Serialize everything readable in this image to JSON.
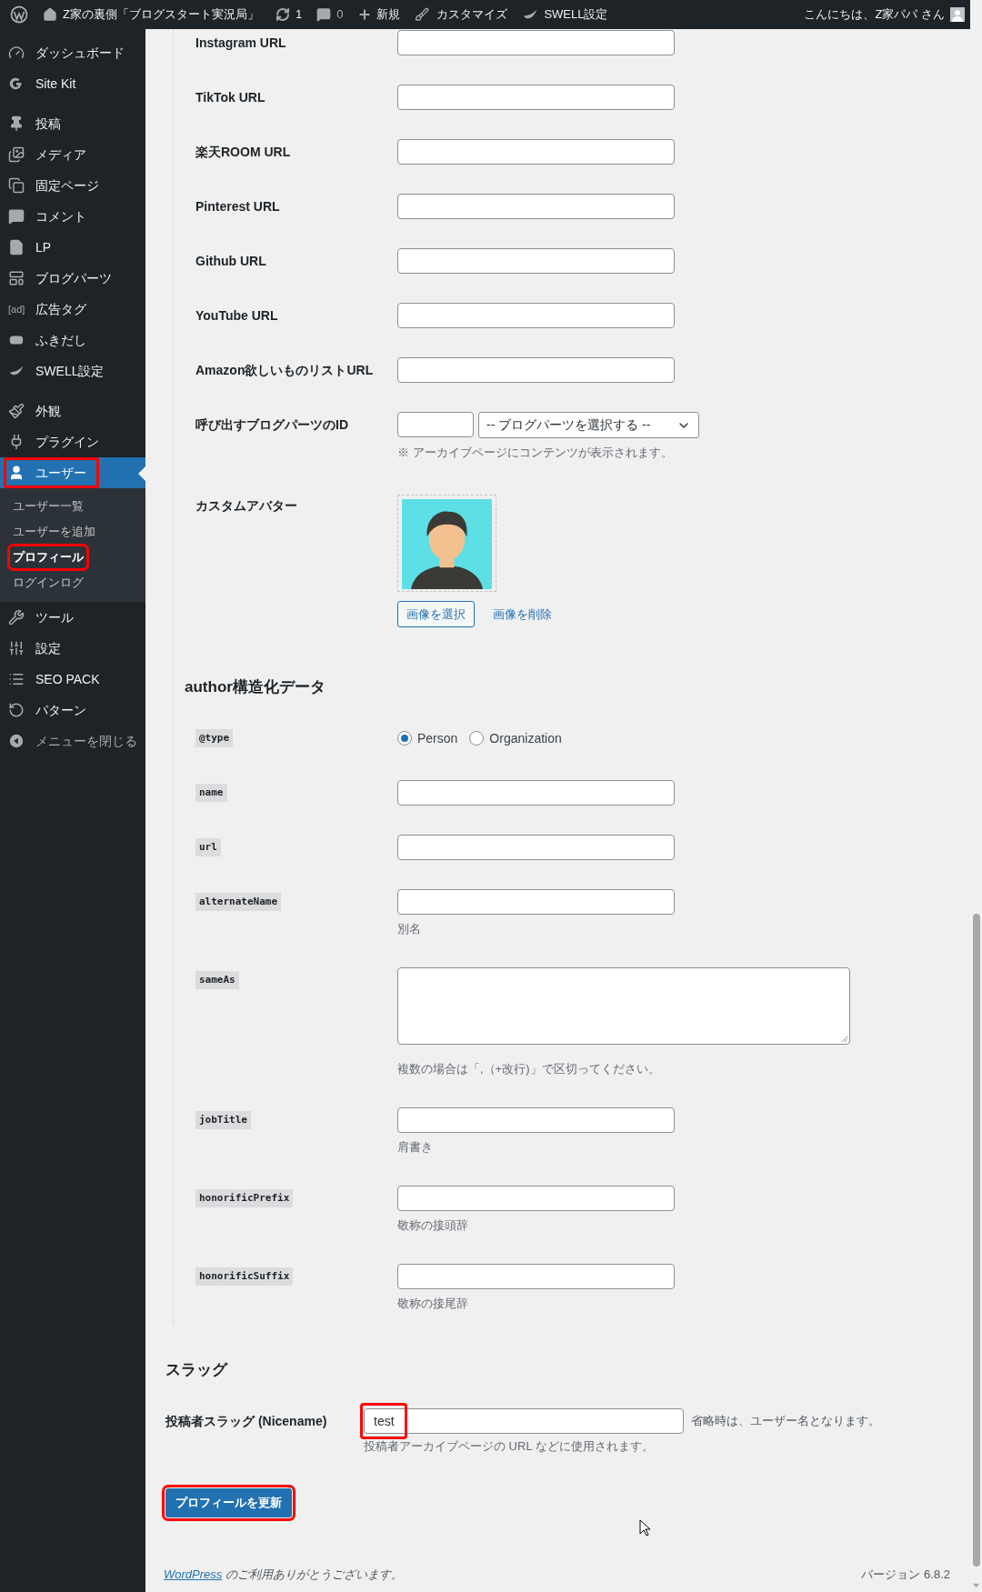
{
  "admin_bar": {
    "site_name": "Z家の裏側「ブログスタート実況局」",
    "updates": "1",
    "comments": "0",
    "new": "新規",
    "customize": "カスタマイズ",
    "swell": "SWELL設定",
    "greeting": "こんにちは、Z家パパ さん"
  },
  "sidebar": {
    "items": [
      {
        "label": "ダッシュボード",
        "selected": false,
        "highlighted": false
      },
      {
        "label": "Site Kit",
        "selected": false,
        "highlighted": false
      },
      {
        "label": "投稿",
        "selected": false,
        "highlighted": false
      },
      {
        "label": "メディア",
        "selected": false,
        "highlighted": false
      },
      {
        "label": "固定ページ",
        "selected": false,
        "highlighted": false
      },
      {
        "label": "コメント",
        "selected": false,
        "highlighted": false
      },
      {
        "label": "LP",
        "selected": false,
        "highlighted": false
      },
      {
        "label": "ブログパーツ",
        "selected": false,
        "highlighted": false
      },
      {
        "label": "広告タグ",
        "icon_text": "[ad]",
        "selected": false,
        "highlighted": false
      },
      {
        "label": "ふきだし",
        "selected": false,
        "highlighted": false
      },
      {
        "label": "SWELL設定",
        "selected": false,
        "highlighted": false
      },
      {
        "label": "外観",
        "selected": false,
        "highlighted": false
      },
      {
        "label": "プラグイン",
        "selected": false,
        "highlighted": false
      },
      {
        "label": "ユーザー",
        "selected": true,
        "highlighted": true,
        "children": [
          {
            "label": "ユーザー一覧",
            "selected": false,
            "highlighted": false
          },
          {
            "label": "ユーザーを追加",
            "selected": false,
            "highlighted": false
          },
          {
            "label": "プロフィール",
            "selected": true,
            "highlighted": true
          },
          {
            "label": "ログインログ",
            "selected": false,
            "highlighted": false
          }
        ]
      },
      {
        "label": "ツール",
        "selected": false,
        "highlighted": false
      },
      {
        "label": "設定",
        "selected": false,
        "highlighted": false
      },
      {
        "label": "SEO PACK",
        "selected": false,
        "highlighted": false
      },
      {
        "label": "パターン",
        "selected": false,
        "highlighted": false
      },
      {
        "label": "メニューを閉じる",
        "selected": false,
        "highlighted": false
      }
    ]
  },
  "profile_fields": [
    {
      "kind": "url",
      "label": "Instagram URL"
    },
    {
      "kind": "url",
      "label": "TikTok URL"
    },
    {
      "kind": "url",
      "label": "楽天ROOM URL"
    },
    {
      "kind": "url",
      "label": "Pinterest URL"
    },
    {
      "kind": "url",
      "label": "Github URL"
    },
    {
      "kind": "url",
      "label": "YouTube URL"
    },
    {
      "kind": "url",
      "label": "Amazon欲しいものリストURL"
    },
    {
      "kind": "blogparts",
      "label": "呼び出すブログパーツのID",
      "select": "-- ブログパーツを選択する --",
      "note": "※ アーカイブページにコンテンツが表示されます。"
    },
    {
      "kind": "avatar",
      "label": "カスタムアバター",
      "select_button": "画像を選択",
      "remove_link": "画像を削除"
    }
  ],
  "author_schema": {
    "heading": "author構造化データ",
    "fields": [
      {
        "kind": "radio",
        "label": "@type",
        "options": [
          {
            "label": "Person",
            "selected": true
          },
          {
            "label": "Organization",
            "selected": false
          }
        ]
      },
      {
        "kind": "text",
        "label": "name"
      },
      {
        "kind": "text",
        "label": "url"
      },
      {
        "kind": "text",
        "label": "alternateName",
        "description": "別名"
      },
      {
        "kind": "textarea",
        "label": "sameAs",
        "description": "複数の場合は「,（+改行)」で区切ってください。"
      },
      {
        "kind": "text",
        "label": "jobTitle",
        "description": "肩書き"
      },
      {
        "kind": "text",
        "label": "honorificPrefix",
        "description": "敬称の接頭辞"
      },
      {
        "kind": "text",
        "label": "honorificSuffix",
        "description": "敬称の接尾辞"
      }
    ]
  },
  "slug": {
    "heading": "スラッグ",
    "label": "投稿者スラッグ (Nicename)",
    "value": "test",
    "highlighted": true,
    "inline_note": "省略時は、ユーザー名となります。",
    "description": "投稿者アーカイブページの URL などに使用されます。"
  },
  "submit": {
    "label": "プロフィールを更新",
    "highlighted": true
  },
  "footer": {
    "link": "WordPress",
    "text": "のご利用ありがとうございます。",
    "version": "バージョン 6.8.2"
  }
}
